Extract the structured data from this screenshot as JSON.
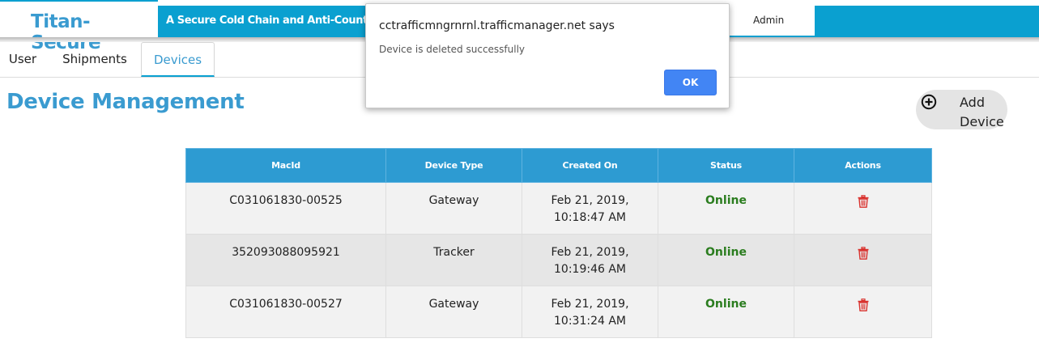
{
  "header": {
    "brand": "Titan-Secure",
    "tagline": "A Secure Cold Chain and Anti-Counterfeit Solution",
    "user_menu_label": "Admin"
  },
  "tabs": [
    {
      "label": "User",
      "active": false
    },
    {
      "label": "Shipments",
      "active": false
    },
    {
      "label": "Devices",
      "active": true
    }
  ],
  "page": {
    "title": "Device Management",
    "add_button_label": "Add Device",
    "add_icon": "plus-circle-icon"
  },
  "table": {
    "columns": [
      "MacId",
      "Device Type",
      "Created On",
      "Status",
      "Actions"
    ],
    "rows": [
      {
        "macid": "C031061830-00525",
        "type": "Gateway",
        "created_date": "Feb 21, 2019,",
        "created_time": "10:18:47 AM",
        "status": "Online"
      },
      {
        "macid": "352093088095921",
        "type": "Tracker",
        "created_date": "Feb 21, 2019,",
        "created_time": "10:19:46 AM",
        "status": "Online"
      },
      {
        "macid": "C031061830-00527",
        "type": "Gateway",
        "created_date": "Feb 21, 2019,",
        "created_time": "10:31:24 AM",
        "status": "Online"
      }
    ],
    "action_icon": "trash-icon"
  },
  "dialog": {
    "title": "cctrafficmngrnrnl.trafficmanager.net says",
    "message": "Device is deleted successfully",
    "ok_label": "OK"
  },
  "colors": {
    "accent": "#0aa0d0",
    "title_blue": "#3a9bd0",
    "table_header": "#2d9bd2",
    "status_online": "#2b7d1f",
    "delete_red": "#d9302c",
    "ok_button": "#4285f4"
  }
}
